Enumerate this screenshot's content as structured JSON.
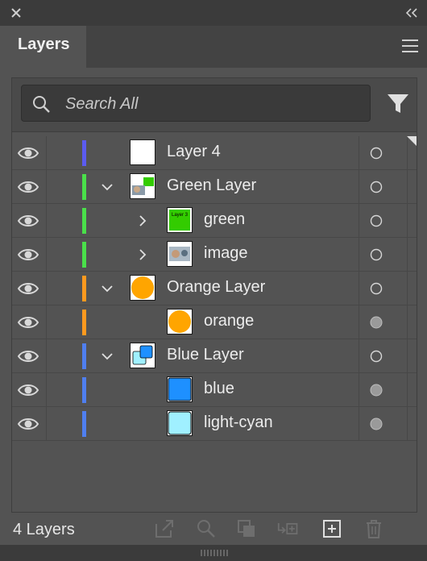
{
  "panel": {
    "tab_title": "Layers"
  },
  "search": {
    "placeholder": "Search All"
  },
  "footer": {
    "layer_count": "4 Layers"
  },
  "colors": {
    "layer4": "#5b5bf0",
    "green": "#4ae04a",
    "orange": "#ff9a1f",
    "blue": "#4f7ff0",
    "orange_fill": "#ffa500",
    "blue_fill": "#1e90ff",
    "cyan_fill": "#a0f0ff",
    "green_fill": "#33cc00"
  },
  "layers": [
    {
      "name": "Layer 4",
      "level": 0,
      "expander": "none",
      "color": "layer4",
      "thumb": "white",
      "target": "hollow"
    },
    {
      "name": "Green Layer",
      "level": 0,
      "expander": "down",
      "color": "green",
      "thumb": "green-layer",
      "target": "hollow"
    },
    {
      "name": "green",
      "level": 1,
      "expander": "right",
      "color": "green",
      "thumb": "green",
      "target": "hollow"
    },
    {
      "name": "image",
      "level": 1,
      "expander": "right",
      "color": "green",
      "thumb": "image",
      "target": "hollow"
    },
    {
      "name": "Orange Layer",
      "level": 0,
      "expander": "down",
      "color": "orange",
      "thumb": "orange-layer",
      "target": "hollow"
    },
    {
      "name": "orange",
      "level": 1,
      "expander": "none",
      "color": "orange",
      "thumb": "orange",
      "target": "filled"
    },
    {
      "name": "Blue Layer",
      "level": 0,
      "expander": "down",
      "color": "blue",
      "thumb": "blue-layer",
      "target": "hollow"
    },
    {
      "name": "blue",
      "level": 1,
      "expander": "none",
      "color": "blue",
      "thumb": "blue",
      "target": "filled"
    },
    {
      "name": "light-cyan",
      "level": 1,
      "expander": "none",
      "color": "blue",
      "thumb": "cyan",
      "target": "filled"
    }
  ],
  "thumb_text": {
    "green": "Layer 3"
  }
}
